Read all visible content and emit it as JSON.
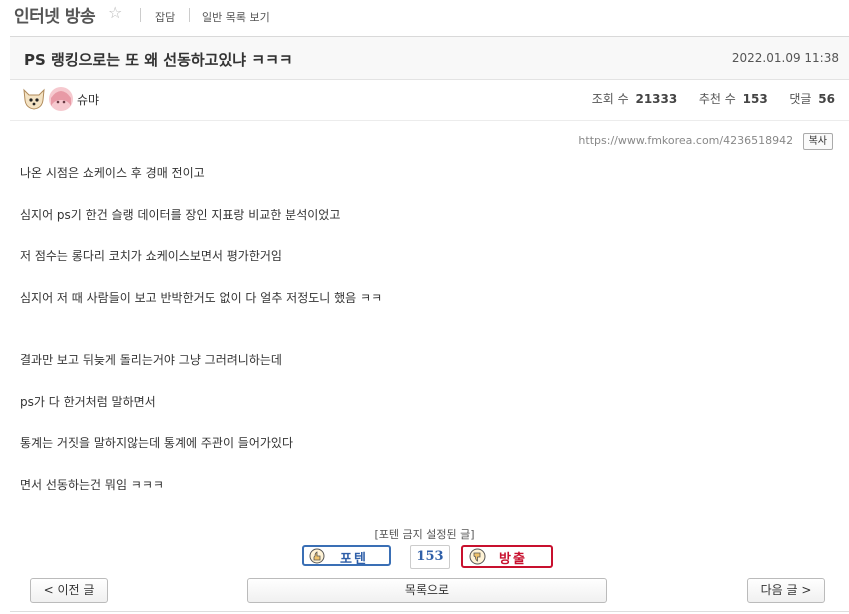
{
  "board": {
    "title": "인터넷 방송",
    "favorite_icon": "star-outline-icon",
    "tabs": [
      "잡담",
      "일반 목록 보기"
    ]
  },
  "post": {
    "title": "PS 랭킹으로는 또 왜 선동하고있냐 ㅋㅋㅋ",
    "date": "2022.01.09 11:38",
    "author": "슈먀",
    "views_label": "조회 수",
    "views": "21333",
    "recommend_label": "추천 수",
    "recommend": "153",
    "comments_label": "댓글",
    "comments": "56",
    "url": "https://www.fmkorea.com/4236518942",
    "copy_label": "복사",
    "lines": [
      "나온 시점은 쇼케이스 후 경매 전이고",
      "심지어 ps기 한건 슬랭 데이터를 장인 지표랑 비교한 분석이었고",
      "저 점수는 롱다리 코치가 쇼케이스보면서 평가한거임",
      "심지어 저 때 사람들이 보고 반박한거도 없이 다 얼추 저정도니 했음 ㅋㅋ",
      "결과만 보고 뒤늦게 돌리는거야 그냥 그러려니하는데",
      "ps가 다 한거처럼 말하면서",
      "통계는 거짓을 말하지않는데 통계에 주관이 들어가있다",
      "면서 선동하는건 뭐임 ㅋㅋㅋ"
    ]
  },
  "vote": {
    "notice": "[포텐 금지 설정된 글]",
    "up_label": "포텐",
    "count": "153",
    "down_label": "방출"
  },
  "nav": {
    "prev": "< 이전 글",
    "list": "목록으로",
    "next": "다음 글 >"
  },
  "colors": {
    "up": "#2f5fa8",
    "down": "#c8102e"
  }
}
